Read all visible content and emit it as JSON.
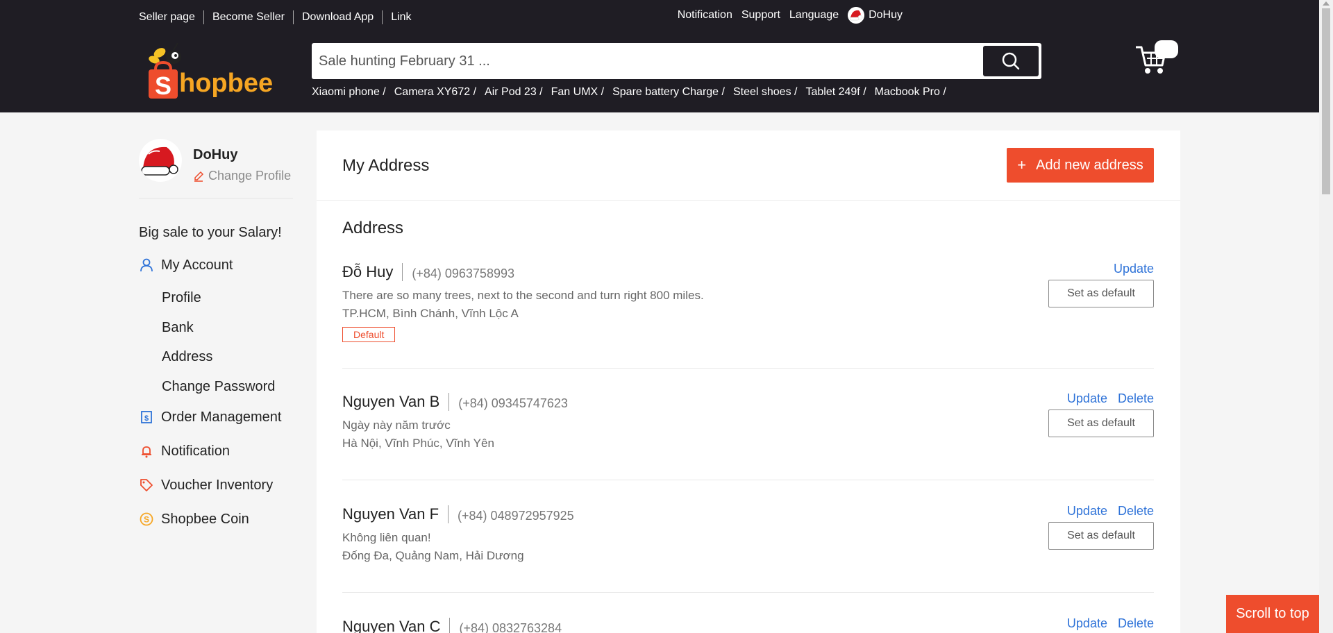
{
  "topnav": {
    "links": [
      "Seller page",
      "Become Seller",
      "Download App",
      "Link"
    ],
    "right": {
      "notification": "Notification",
      "support": "Support",
      "language": "Language",
      "username": "DoHuy"
    }
  },
  "brand": {
    "name": "Shopbee",
    "accent": "#ee4d2d",
    "header_bg": "#1f1d24"
  },
  "search": {
    "placeholder": "Sale hunting February 31 ...",
    "icon": "search-icon",
    "suggestions": [
      "Xiaomi phone /",
      "Camera XY672 /",
      "Air Pod 23 /",
      "Fan UMX /",
      "Spare battery Charge /",
      "Steel shoes /",
      "Tablet 249f /",
      "Macbook Pro /"
    ]
  },
  "cart": {
    "icon": "cart-icon"
  },
  "profile": {
    "name": "DoHuy",
    "edit_label": "Change Profile"
  },
  "sidebar": {
    "promo": "Big sale to your Salary!",
    "my_account": "My Account",
    "sub_items": [
      "Profile",
      "Bank",
      "Address",
      "Change Password"
    ],
    "order_management": "Order Management",
    "notification": "Notification",
    "voucher": "Voucher Inventory",
    "coin": "Shopbee Coin"
  },
  "main": {
    "title": "My Address",
    "add_button": "Add new address",
    "section_title": "Address",
    "set_default_label": "Set as default",
    "update_label": "Update",
    "delete_label": "Delete",
    "default_tag": "Default",
    "addresses": [
      {
        "name": "Đỗ Huy",
        "phone": "(+84) 0963758993",
        "line1": "There are so many trees, next to the second and turn right 800 miles.",
        "line2": "TP.HCM, Bình Chánh, Vĩnh Lộc A",
        "is_default": true
      },
      {
        "name": "Nguyen Van B",
        "phone": "(+84) 09345747623",
        "line1": "Ngày này năm trước",
        "line2": "Hà Nội, Vĩnh Phúc, Vĩnh Yên",
        "is_default": false
      },
      {
        "name": "Nguyen Van F",
        "phone": "(+84) 048972957925",
        "line1": "Không liên quan!",
        "line2": "Đống Đa, Quảng Nam, Hải Dương",
        "is_default": false
      },
      {
        "name": "Nguyen Van C",
        "phone": "(+84) 0832763284",
        "line1": "",
        "line2": "",
        "is_default": false
      }
    ]
  },
  "scroll_top": "Scroll to top"
}
